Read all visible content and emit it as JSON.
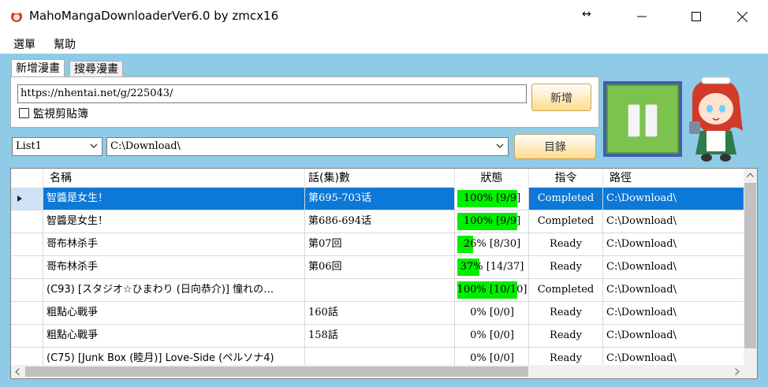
{
  "window": {
    "title": "MahoMangaDownloaderVer6.0 by zmcx16"
  },
  "menu": [
    "選單",
    "幫助"
  ],
  "tabs": [
    "新增漫畫",
    "搜尋漫畫"
  ],
  "add": {
    "url_value": "https://nhentai.net/g/225043/",
    "add_button": "新增",
    "monitor_clipboard_label": "監視剪貼簿",
    "monitor_clipboard_checked": false
  },
  "list_select": "List1",
  "directory_value": "C:\\Download\\",
  "directory_button": "目錄",
  "table": {
    "headers": [
      "名稱",
      "話(集)數",
      "狀態",
      "指令",
      "路徑"
    ],
    "rows": [
      {
        "name": "智醬是女生！",
        "episode": "第695-703话",
        "progress": 100,
        "status": "100% [9/9]",
        "command": "Completed",
        "path": "C:\\Download\\",
        "selected": true
      },
      {
        "name": "智醬是女生！",
        "episode": "第686-694话",
        "progress": 100,
        "status": "100% [9/9]",
        "command": "Completed",
        "path": "C:\\Download\\"
      },
      {
        "name": "哥布林杀手",
        "episode": "第07回",
        "progress": 26,
        "status": "26% [8/30]",
        "command": "Ready",
        "path": "C:\\Download\\"
      },
      {
        "name": "哥布林杀手",
        "episode": "第06回",
        "progress": 37,
        "status": "37% [14/37]",
        "command": "Ready",
        "path": "C:\\Download\\"
      },
      {
        "name": "(C93) [スタジオ☆ひまわり (日向恭介)] 憧れの…",
        "episode": "",
        "progress": 100,
        "status": "100% [10/10]",
        "command": "Completed",
        "path": "C:\\Download\\"
      },
      {
        "name": "粗點心戰爭",
        "episode": "160話",
        "progress": 0,
        "status": "0% [0/0]",
        "command": "Ready",
        "path": "C:\\Download\\"
      },
      {
        "name": "粗點心戰爭",
        "episode": "158話",
        "progress": 0,
        "status": "0% [0/0]",
        "command": "Ready",
        "path": "C:\\Download\\"
      },
      {
        "name": "(C75) [Junk Box (睦月)] Love-Side (ペルソナ4)",
        "episode": "",
        "progress": 0,
        "status": "0% [0/0]",
        "command": "Ready",
        "path": "C:\\Download\\"
      }
    ]
  },
  "icons": {
    "app": "maid-app-icon",
    "resize": "double-arrow-icon",
    "pause": "pause-icon",
    "mascot": "maid-mascot-icon"
  }
}
